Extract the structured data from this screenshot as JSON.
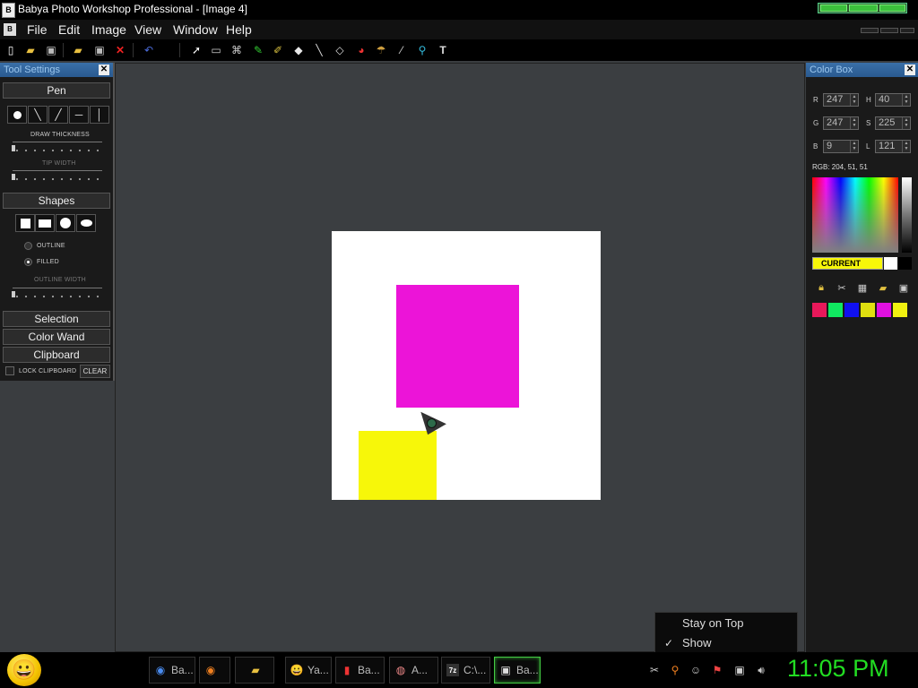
{
  "window": {
    "title": "Babya Photo Workshop Professional - [Image  4]",
    "app_icon_text": "B"
  },
  "menu": {
    "icon_text": "B",
    "items": [
      "File",
      "Edit",
      "Image",
      "View",
      "Window",
      "Help"
    ]
  },
  "toolbar": {
    "icons": [
      "new-file",
      "open-folder",
      "save",
      "open-folder-2",
      "save-2",
      "close-red-x",
      "undo",
      "pointer",
      "rectangle-select",
      "lasso",
      "pen",
      "brush",
      "eraser",
      "line",
      "fill-bucket",
      "color-replace",
      "shape-tool",
      "eyedropper",
      "zoom",
      "text"
    ]
  },
  "tool_settings": {
    "title": "Tool Settings",
    "pen": {
      "heading": "Pen",
      "draw_thickness_label": "DRAW THICKNESS",
      "draw_thickness_level": 0,
      "tip_width_label": "TIP WIDTH",
      "tip_width_level": 0
    },
    "shapes": {
      "heading": "Shapes",
      "outline_label": "OUTLINE",
      "filled_label": "FILLED",
      "selected": "FILLED",
      "outline_width_label": "OUTLINE WIDTH"
    },
    "selection_label": "Selection",
    "color_wand_label": "Color Wand",
    "clipboard_label": "Clipboard",
    "lock_clipboard_label": "LOCK CLIPBOARD",
    "clear_label": "CLEAR"
  },
  "canvas": {
    "background": "#ffffff",
    "magenta": "#ec14d8",
    "yellow": "#f7f709"
  },
  "color_box": {
    "title": "Color Box",
    "r_label": "R",
    "r_value": "247",
    "g_label": "G",
    "g_value": "247",
    "b_label": "B",
    "b_value": "9",
    "h_label": "H",
    "h_value": "40",
    "s_label": "S",
    "s_value": "225",
    "l_label": "L",
    "l_value": "121",
    "rgb_readout": "RGB: 204, 51, 51",
    "current_label": "CURRENT",
    "current_color": "#f7f709",
    "secondary_colors": [
      "#ffffff",
      "#000000"
    ],
    "palette": [
      "#e8185a",
      "#10e860",
      "#1010f0",
      "#e0e010",
      "#e010e0",
      "#f0f010"
    ]
  },
  "tray_popup": {
    "stay_on_top": "Stay on Top",
    "show": "Show",
    "checkmark": "✓"
  },
  "taskbar": {
    "tasks": [
      {
        "label": "Ba...",
        "icon": "chrome-icon"
      },
      {
        "label": "",
        "icon": "firefox-icon"
      },
      {
        "label": "",
        "icon": "folder-icon"
      },
      {
        "label": "Ya...",
        "icon": "yahoo-smiley-icon"
      },
      {
        "label": "Ba...",
        "icon": "app-icon"
      },
      {
        "label": "A...",
        "icon": "avatar-app-icon"
      },
      {
        "label": "C:\\...",
        "icon": "7zip-icon"
      },
      {
        "label": "Ba...",
        "icon": "babya-icon"
      }
    ],
    "clock": "11:05 PM"
  }
}
